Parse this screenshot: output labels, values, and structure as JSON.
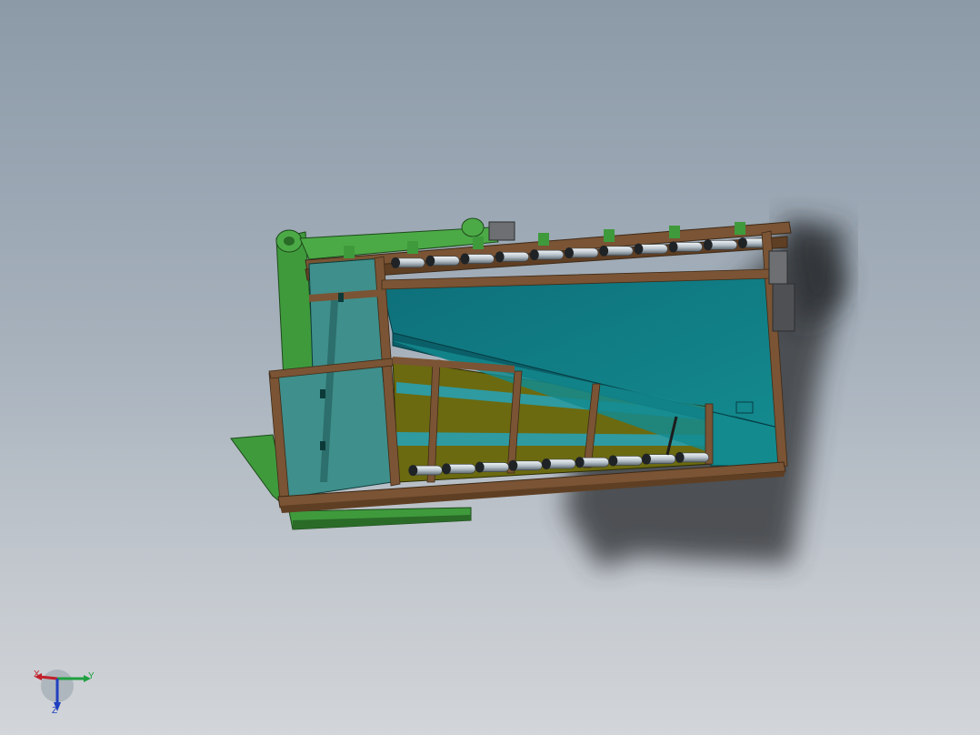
{
  "viewport": {
    "background_top": "#8c9aa8",
    "background_bottom": "#d2d5d9"
  },
  "model": {
    "colors": {
      "frame": "#6b4a2c",
      "frame_dark": "#3e2a18",
      "panel": "#0f7a84",
      "panel_light": "#2f9aa0",
      "inner_floor": "#6b6a10",
      "green_part": "#3f9a3c",
      "green_dark": "#2a6b28",
      "roller": "#c9d4dc",
      "shadow": "#3b3d40"
    }
  },
  "triad": {
    "x_label": "X",
    "y_label": "Y",
    "z_label": "Z",
    "x_color": "#c0202a",
    "y_color": "#20a040",
    "z_color": "#2040c0"
  }
}
